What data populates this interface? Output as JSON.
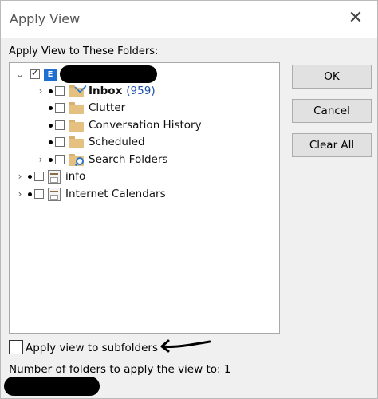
{
  "window": {
    "title": "Apply View"
  },
  "labels": {
    "folders": "Apply View to These Folders:",
    "subfolders": "Apply view to subfolders",
    "count": "Number of folders to apply the view to: 1"
  },
  "tree": {
    "account": {
      "checked": true,
      "icon": "exchange-icon",
      "label_redacted": true
    },
    "items": [
      {
        "label": "Inbox",
        "count": "(959)",
        "bold": true,
        "checked": false,
        "expandable": true,
        "icon": "inbox-folder-icon"
      },
      {
        "label": "Clutter",
        "checked": false,
        "expandable": false,
        "icon": "folder-icon"
      },
      {
        "label": "Conversation History",
        "checked": false,
        "expandable": false,
        "icon": "folder-icon"
      },
      {
        "label": "Scheduled",
        "checked": false,
        "expandable": false,
        "icon": "folder-icon"
      },
      {
        "label": "Search Folders",
        "checked": false,
        "expandable": true,
        "icon": "search-folder-icon"
      }
    ],
    "other_accounts": [
      {
        "label": "info",
        "checked": false,
        "expandable": true,
        "icon": "calendar-icon"
      },
      {
        "label": "Internet Calendars",
        "checked": false,
        "expandable": true,
        "icon": "calendar-icon"
      }
    ]
  },
  "buttons": {
    "ok": "OK",
    "cancel": "Cancel",
    "clear_all": "Clear All"
  },
  "colors": {
    "count": "#1a4fb0",
    "accent": "#1f6fd2",
    "folder": "#e5c181"
  }
}
